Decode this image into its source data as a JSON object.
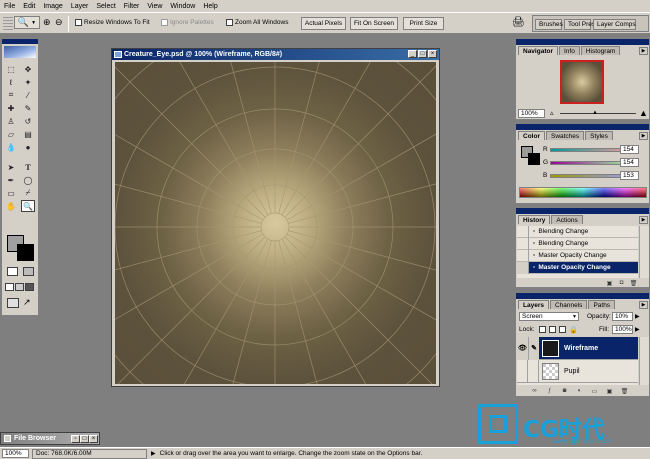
{
  "menu": [
    "File",
    "Edit",
    "Image",
    "Layer",
    "Select",
    "Filter",
    "View",
    "Window",
    "Help"
  ],
  "options": {
    "resize_windows": "Resize Windows To Fit",
    "ignore_palettes": "Ignore Palettes",
    "zoom_all_windows": "Zoom All Windows",
    "actual_pixels": "Actual Pixels",
    "fit_on_screen": "Fit On Screen",
    "print_size": "Print Size"
  },
  "palette_well": [
    "Brushes",
    "Tool Presets",
    "Layer Comps"
  ],
  "document": {
    "title": "Creature_Eye.psd @ 100% (Wireframe, RGB/8#)"
  },
  "navigator": {
    "tabs": [
      "Navigator",
      "Info",
      "Histogram"
    ],
    "zoom": "100%"
  },
  "color": {
    "tabs": [
      "Color",
      "Swatches",
      "Styles"
    ],
    "channels": [
      {
        "label": "R",
        "value": "154"
      },
      {
        "label": "G",
        "value": "154"
      },
      {
        "label": "B",
        "value": "153"
      }
    ]
  },
  "history": {
    "tabs": [
      "History",
      "Actions"
    ],
    "items": [
      "Blending Change",
      "Blending Change",
      "Master Opacity Change",
      "Master Opacity Change"
    ]
  },
  "layers": {
    "tabs": [
      "Layers",
      "Channels",
      "Paths"
    ],
    "blend_mode": "Screen",
    "opacity_label": "Opacity:",
    "opacity": "10%",
    "lock_label": "Lock:",
    "fill_label": "Fill:",
    "fill": "100%",
    "items": [
      "Wireframe",
      "Pupil"
    ]
  },
  "file_browser": {
    "title": "File Browser"
  },
  "status": {
    "zoom": "100%",
    "doc": "Doc: 768.0K/6.00M",
    "hint": "Click or drag over the area you want to enlarge. Change the zoom state on the Options bar."
  },
  "watermark": {
    "brand": "CG时代",
    "url": "www.cgtime.com.cn"
  },
  "colors": {
    "title_active": "#0a246a",
    "canvas_center": "#d8caa0",
    "canvas_edge": "#5a4f3a",
    "wire": "#a69774",
    "watermark": "#1aa0d8"
  }
}
